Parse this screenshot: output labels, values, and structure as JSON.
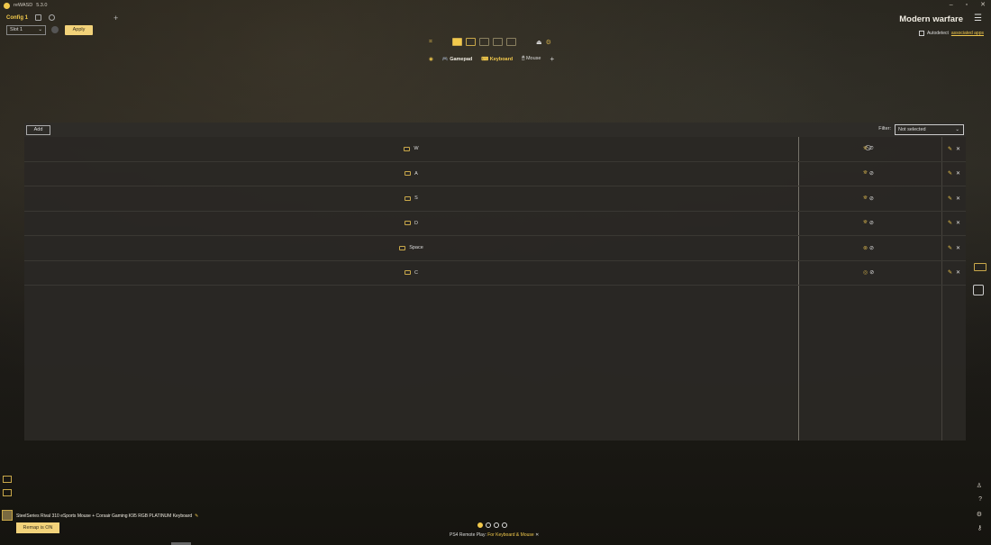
{
  "app": {
    "name": "reWASD",
    "version": "5.3.0"
  },
  "window": {
    "minimize": "–",
    "maximize": "▫",
    "close": "✕"
  },
  "config": {
    "name": "Config 1",
    "add_label": "+",
    "slot_value": "Slot 1",
    "apply_label": "Apply"
  },
  "profile": {
    "title": "Modern warfare",
    "menu_icon": "☰"
  },
  "autodetect": {
    "label": "Autodetect",
    "link": "associated apps"
  },
  "mode_tabs": [
    {
      "label": "Gamepad"
    },
    {
      "label": "Keyboard"
    },
    {
      "label": "Mouse"
    }
  ],
  "panel": {
    "add_label": "Add",
    "filter_label": "Filter:",
    "filter_value": "Not selected"
  },
  "mappings": [
    {
      "key": "W",
      "action_icon": "gamepad-stick-up-icon",
      "action": "⛯"
    },
    {
      "key": "A",
      "action_icon": "gamepad-stick-left-icon",
      "action": "⛯"
    },
    {
      "key": "S",
      "action_icon": "gamepad-stick-down-icon",
      "action": "⛯"
    },
    {
      "key": "D",
      "action_icon": "gamepad-stick-right-icon",
      "action": "⛯"
    },
    {
      "key": "Space",
      "action_icon": "gamepad-a-button-icon",
      "action": "⊗"
    },
    {
      "key": "C",
      "action_icon": "gamepad-b-button-icon",
      "action": "◎"
    }
  ],
  "footer": {
    "devices": "SteelSeries Rival 310 eSports Mouse + Corsair Gaming K95 RGB PLATINUM Keyboard",
    "remap_label": "Remap is ON",
    "ps4_label": "PS4 Remote Play:",
    "ps4_link": "For Keyboard & Mouse",
    "ps4_close": "✕"
  },
  "colors": {
    "accent": "#f2c94c",
    "panel": "#2a2824"
  }
}
